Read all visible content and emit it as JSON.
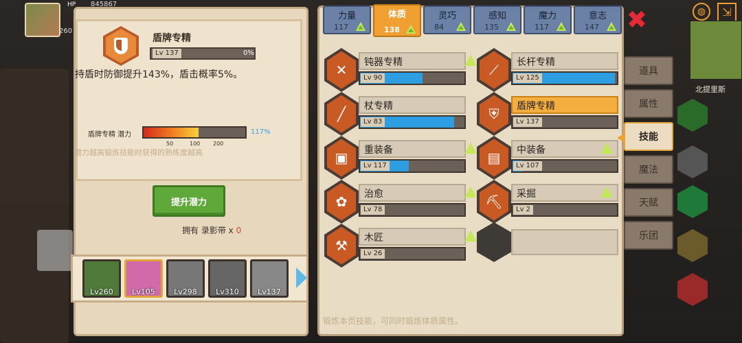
{
  "hero": {
    "hp_label": "HP",
    "hp_value": "845867",
    "level_short": "260"
  },
  "detail": {
    "skill_name": "盾牌专精",
    "level": "Lv 137",
    "progress_pct": "0%",
    "description": "持盾时防御提升143%，盾击概率5%。",
    "potential_label": "盾牌专精 潜力",
    "potential_pct": "117%",
    "potential_fraction": 0.53,
    "ticks": [
      "50",
      "100",
      "200"
    ],
    "note": "潜力越高锻炼技能时获得的熟练度越高",
    "boost_button": "提升潜力",
    "owned_prefix": "拥有 录影带 x",
    "owned_count": "0"
  },
  "hero_roster": [
    {
      "level": "Lv260",
      "color": "#4f7a3a"
    },
    {
      "level": "Lv105",
      "color": "#d06aa8"
    },
    {
      "level": "Lv298",
      "color": "#777777"
    },
    {
      "level": "Lv310",
      "color": "#666666"
    },
    {
      "level": "Lv137",
      "color": "#888888"
    }
  ],
  "stat_tabs": [
    {
      "name": "力量",
      "value": "117"
    },
    {
      "name": "体质",
      "value": "138"
    },
    {
      "name": "灵巧",
      "value": "84"
    },
    {
      "name": "感知",
      "value": "135"
    },
    {
      "name": "魔力",
      "value": "117"
    },
    {
      "name": "意志",
      "value": "147"
    }
  ],
  "skills": [
    {
      "name": "钝器专精",
      "level": "Lv 90",
      "fill": 0.6,
      "icon": "hammer-icon",
      "glyph": "✕"
    },
    {
      "name": "长杆专精",
      "level": "Lv 125",
      "fill": 0.98,
      "icon": "spear-icon",
      "glyph": "⟋"
    },
    {
      "name": "杖专精",
      "level": "Lv 83",
      "fill": 0.9,
      "icon": "staff-icon",
      "glyph": "╱"
    },
    {
      "name": "盾牌专精",
      "level": "Lv 137",
      "fill": 0.0,
      "icon": "shield-icon",
      "glyph": "⛨"
    },
    {
      "name": "重装备",
      "level": "Lv 117",
      "fill": 0.47,
      "icon": "heavy-armor-icon",
      "glyph": "▣"
    },
    {
      "name": "中装备",
      "level": "Lv 107",
      "fill": 0.1,
      "icon": "medium-armor-icon",
      "glyph": "▤"
    },
    {
      "name": "治愈",
      "level": "Lv 78",
      "fill": 0.0,
      "icon": "heal-icon",
      "glyph": "✿"
    },
    {
      "name": "采掘",
      "level": "Lv 2",
      "fill": 0.0,
      "icon": "pickaxe-icon",
      "glyph": "⛏"
    },
    {
      "name": "木匠",
      "level": "Lv 26",
      "fill": 0.0,
      "icon": "saw-icon",
      "glyph": "⚒"
    }
  ],
  "side_menu": [
    "道具",
    "属性",
    "技能",
    "魔法",
    "天赋",
    "乐团"
  ],
  "footer_note": "锻炼本页技能，可同时锻炼体质属性。",
  "minimap_label": "北提里斯",
  "close_symbol": "✖",
  "colors": {
    "accent": "#f0a030",
    "bar_blue": "#2e9ee3",
    "close_red": "#e52b36"
  }
}
